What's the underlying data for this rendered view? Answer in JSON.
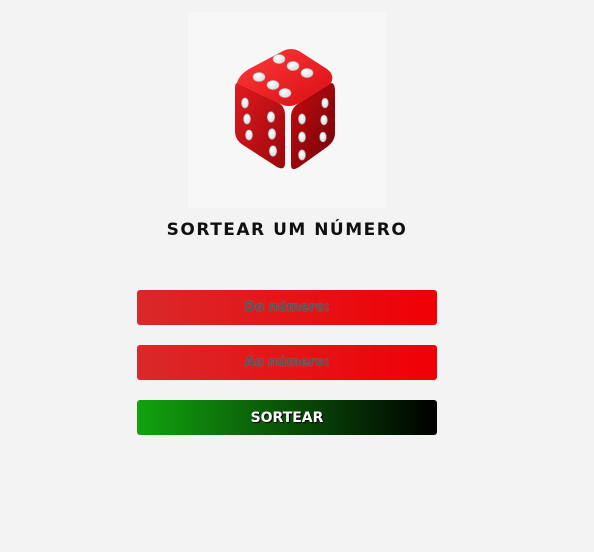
{
  "page": {
    "title": "SORTEAR UM NÚMERO"
  },
  "image": {
    "icon": "dice-icon",
    "colors": {
      "dice_body": "#d80d12",
      "dice_shadow": "#7d0508",
      "pip": "#ffffff"
    }
  },
  "form": {
    "from_input": {
      "placeholder": "Do número:",
      "value": ""
    },
    "to_input": {
      "placeholder": "Ao número:",
      "value": ""
    },
    "submit_label": "SORTEAR"
  },
  "colors": {
    "background": "#f3f3f3",
    "field_gradient_start": "#d9292a",
    "field_gradient_end": "#f00005",
    "button_gradient_start": "#12a30f",
    "button_gradient_end": "#000000"
  }
}
